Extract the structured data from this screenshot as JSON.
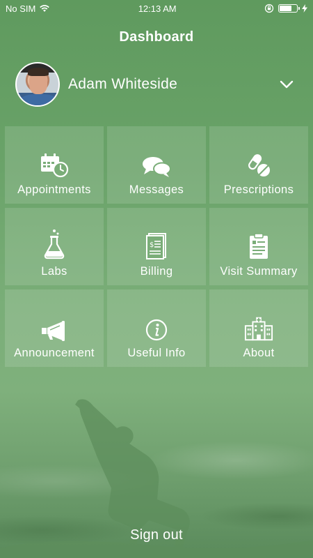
{
  "status_bar": {
    "carrier": "No SIM",
    "time": "12:13 AM",
    "battery_level": 0.7,
    "icons": [
      "wifi-icon",
      "orientation-lock-icon",
      "battery-icon",
      "charging-icon"
    ]
  },
  "header": {
    "title": "Dashboard"
  },
  "profile": {
    "name": "Adam Whiteside",
    "avatar_icon": "avatar",
    "chevron_icon": "chevron-down-icon"
  },
  "tiles": [
    {
      "label": "Appointments",
      "icon": "calendar-clock-icon"
    },
    {
      "label": "Messages",
      "icon": "chat-bubbles-icon"
    },
    {
      "label": "Prescriptions",
      "icon": "pills-icon"
    },
    {
      "label": "Labs",
      "icon": "flask-icon"
    },
    {
      "label": "Billing",
      "icon": "bill-icon"
    },
    {
      "label": "Visit Summary",
      "icon": "clipboard-icon"
    },
    {
      "label": "Announcement",
      "icon": "megaphone-icon"
    },
    {
      "label": "Useful Info",
      "icon": "info-icon"
    },
    {
      "label": "About",
      "icon": "hospital-icon"
    }
  ],
  "footer": {
    "signout_label": "Sign out"
  },
  "colors": {
    "background": "#6aa369",
    "tile": "rgba(255,255,255,0.13)",
    "text": "#ffffff"
  }
}
